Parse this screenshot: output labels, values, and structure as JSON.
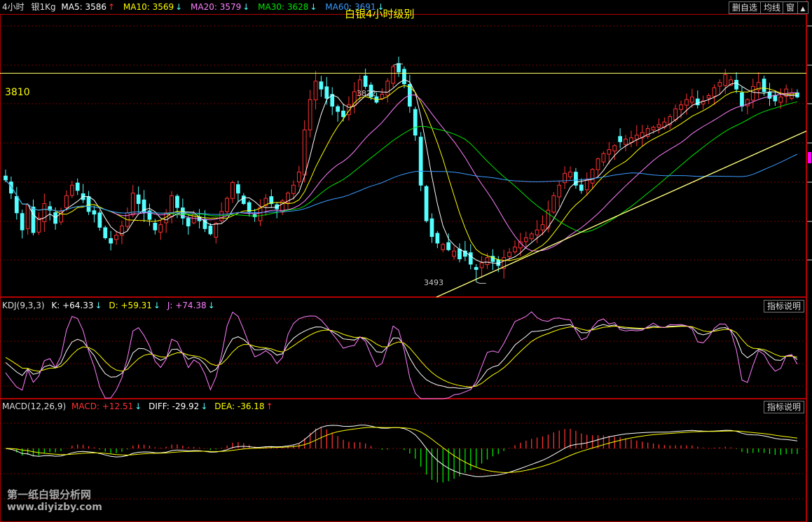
{
  "header": {
    "period": "4小时",
    "symbol": "银1Kg",
    "ma5": "MA5: 3586",
    "ma5_arrow": "↑",
    "ma10": "MA10: 3569",
    "ma10_arrow": "↓",
    "ma20": "MA20: 3579",
    "ma20_arrow": "↓",
    "ma30": "MA30: 3628",
    "ma30_arrow": "↓",
    "ma60": "MA60: 3691",
    "ma60_arrow": "↓",
    "title": "白银4小时级别"
  },
  "toolbar": {
    "remove_favorite": "删自选",
    "ma_line": "均线",
    "window": "窗"
  },
  "kdj": {
    "label": "KDJ(9,3,3)",
    "k": "K: +64.33",
    "k_arrow": "↓",
    "d": "D: +59.31",
    "d_arrow": "↓",
    "j": "J: +74.38",
    "j_arrow": "↓",
    "help": "指标说明"
  },
  "macd": {
    "label": "MACD(12,26,9)",
    "macd": "MACD: +12.51",
    "macd_arrow": "↓",
    "diff": "DIFF: -29.92",
    "diff_arrow": "↓",
    "dea": "DEA: -36.18",
    "dea_arrow": "↑",
    "help": "指标说明"
  },
  "annotations": {
    "level": "3810",
    "high": "3822",
    "low": "3493"
  },
  "watermark": {
    "line1": "第一纸白银分析网",
    "line2": "www.diyizby.com"
  },
  "colors": {
    "up": "#ff3232",
    "down": "#54ffff",
    "ma5": "#ffffff",
    "ma10": "#ffff00",
    "ma20": "#ff80ff",
    "ma30": "#00e600",
    "ma60": "#3c9bff",
    "grid": "#7a0000"
  },
  "chart_data": [
    {
      "type": "candlestick",
      "title": "白银4小时级别",
      "ylim": [
        3470,
        3900
      ],
      "horizontal_line": 3810,
      "max_marker": 3822,
      "min_marker": 3493,
      "close": [
        3648,
        3628,
        3598,
        3572,
        3610,
        3568,
        3590,
        3612,
        3602,
        3582,
        3600,
        3624,
        3640,
        3632,
        3618,
        3600,
        3596,
        3576,
        3560,
        3552,
        3564,
        3578,
        3598,
        3628,
        3612,
        3598,
        3588,
        3572,
        3580,
        3598,
        3624,
        3606,
        3590,
        3578,
        3596,
        3586,
        3574,
        3566,
        3582,
        3600,
        3620,
        3644,
        3628,
        3612,
        3600,
        3592,
        3606,
        3620,
        3612,
        3604,
        3616,
        3628,
        3640,
        3660,
        3724,
        3770,
        3798,
        3786,
        3772,
        3760,
        3752,
        3744,
        3762,
        3782,
        3800,
        3790,
        3774,
        3766,
        3778,
        3798,
        3820,
        3812,
        3794,
        3760,
        3716,
        3640,
        3586,
        3562,
        3552,
        3550,
        3542,
        3540,
        3528,
        3532,
        3520,
        3512,
        3522,
        3530,
        3524,
        3518,
        3530,
        3538,
        3546,
        3554,
        3560,
        3566,
        3572,
        3580,
        3602,
        3624,
        3640,
        3658,
        3660,
        3640,
        3632,
        3648,
        3664,
        3680,
        3688,
        3694,
        3700,
        3706,
        3710,
        3712,
        3716,
        3720,
        3726,
        3728,
        3732,
        3736,
        3744,
        3756,
        3762,
        3770,
        3774,
        3762,
        3768,
        3776,
        3788,
        3796,
        3808,
        3800,
        3786,
        3760,
        3770,
        3790,
        3796,
        3782,
        3772,
        3768,
        3774,
        3786,
        3780,
        3774
      ],
      "moving_averages": [
        {
          "name": "MA5",
          "last": 3586
        },
        {
          "name": "MA10",
          "last": 3569
        },
        {
          "name": "MA20",
          "last": 3579
        },
        {
          "name": "MA30",
          "last": 3628
        },
        {
          "name": "MA60",
          "last": 3691
        }
      ]
    },
    {
      "type": "line",
      "title": "KDJ(9,3,3)",
      "series": [
        {
          "name": "K",
          "last": 64.33
        },
        {
          "name": "D",
          "last": 59.31
        },
        {
          "name": "J",
          "last": 74.38
        }
      ]
    },
    {
      "type": "bar",
      "title": "MACD(12,26,9)",
      "series": [
        {
          "name": "MACD",
          "last": 12.51
        },
        {
          "name": "DIFF",
          "last": -29.92
        },
        {
          "name": "DEA",
          "last": -36.18
        }
      ]
    }
  ]
}
